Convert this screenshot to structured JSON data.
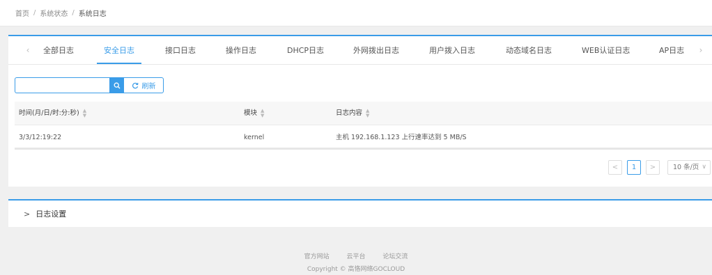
{
  "breadcrumb": {
    "items": [
      "首页",
      "系统状态",
      "系统日志"
    ],
    "separator": "/"
  },
  "tabs": {
    "prev_icon": "chevron-left-icon",
    "next_icon": "chevron-right-icon",
    "items": [
      {
        "label": "全部日志"
      },
      {
        "label": "安全日志",
        "active": true
      },
      {
        "label": "接口日志"
      },
      {
        "label": "操作日志"
      },
      {
        "label": "DHCP日志"
      },
      {
        "label": "外网拨出日志"
      },
      {
        "label": "用户拨入日志"
      },
      {
        "label": "动态域名日志"
      },
      {
        "label": "WEB认证日志"
      },
      {
        "label": "AP日志"
      }
    ]
  },
  "search": {
    "value": "",
    "placeholder": "",
    "search_icon": "search-icon",
    "refresh_icon": "refresh-icon",
    "refresh_label": "刷新"
  },
  "table": {
    "columns": [
      "时间(月/日/时:分:秒)",
      "模块",
      "日志内容"
    ],
    "rows": [
      [
        "3/3/12:19:22",
        "kernel",
        "主机 192.168.1.123 上行速率达到 5 MB/S"
      ]
    ]
  },
  "pagination": {
    "prev": "<",
    "current_page": "1",
    "next": ">",
    "page_size": "10 条/页"
  },
  "settings": {
    "caret": ">",
    "label": "日志设置"
  },
  "footer": {
    "links": [
      "官方网站",
      "云平台",
      "论坛交流"
    ],
    "copyright": "Copyright © 高恪网络GOCLOUD"
  },
  "colors": {
    "accent": "#3a9ce8",
    "background": "#f0f0f0",
    "panel": "#ffffff"
  }
}
